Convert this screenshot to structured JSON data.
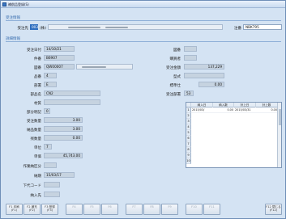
{
  "window": {
    "title": "補償品登録(S)"
  },
  "header": {
    "section_label": "受注情報",
    "customer_label": "受注先",
    "customer_code": "003",
    "customer_code2": "(株)",
    "note_label": "注番",
    "note_value": "NBK795"
  },
  "detail": {
    "section_label": "詳細情報",
    "order_date_label": "受注日付",
    "order_date": "14/10/21",
    "case_no_label": "件番",
    "case_no": "B6907",
    "drawing_label": "図番",
    "drawing": "QW00007",
    "kind_label": "品番",
    "kind": "4",
    "dept_label": "部署",
    "dept": "E",
    "part_name_label": "部品名",
    "part_name": "CN2",
    "material_label": "材質",
    "material": "",
    "partial_label": "部分明記",
    "partial": "0",
    "order_qty_label": "受注数量",
    "order_qty": "3.00",
    "delivered_qty_label": "納品数量",
    "delivered_qty": "3.00",
    "remaining_qty_label": "残数量",
    "remaining_qty": "0.00",
    "unit_label": "単位",
    "unit": "7",
    "unit_price_label": "単価",
    "unit_price": "45,743.00",
    "ship_type_label": "作業納区分",
    "ship_type": "",
    "due_label": "納期",
    "due": "15/03/17",
    "vendor_code_label": "下代コード",
    "vendor_code": "",
    "receiver_label": "納入先",
    "receiver": ""
  },
  "right": {
    "drawing_no_label": "図番",
    "drawing_no": "",
    "buyer_label": "購買者",
    "buyer": "",
    "amount_label": "受注金額",
    "amount": "137,229",
    "type_label": "型式",
    "type": "",
    "standard_label": "標準仕",
    "standard": "0.00",
    "order_dept_label": "受注部署",
    "order_dept": "53"
  },
  "grid": {
    "columns": [
      "納入日",
      "納入数",
      "計上日",
      "計上数"
    ],
    "row_numbers": [
      "1",
      "2",
      "3",
      "4",
      "5",
      "6",
      "7",
      "8",
      "9",
      "10"
    ],
    "rows": [
      [
        "2015/03/",
        "0.00",
        "2015/03/31",
        "0.00"
      ]
    ]
  },
  "function_keys": [
    {
      "label": "F1 印刷",
      "sub": "(F1)"
    },
    {
      "label": "F2 補充",
      "sub": "(F2)"
    },
    {
      "label": "F3 登録",
      "sub": "(F3)"
    },
    {
      "label": "F4",
      "sub": ""
    },
    {
      "label": "F5",
      "sub": ""
    },
    {
      "label": "F6",
      "sub": ""
    },
    {
      "label": "F7",
      "sub": ""
    },
    {
      "label": "F8",
      "sub": ""
    },
    {
      "label": "F9",
      "sub": ""
    },
    {
      "label": "F10",
      "sub": ""
    },
    {
      "label": "F11",
      "sub": ""
    },
    {
      "label": "F12 閉じる",
      "sub": "(F12)"
    }
  ]
}
